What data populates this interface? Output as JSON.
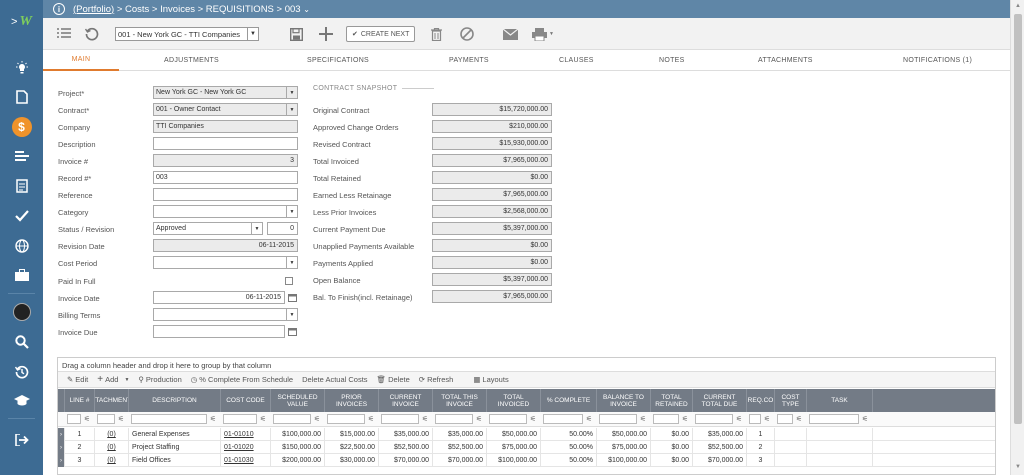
{
  "breadcrumb": {
    "portfolio": "(Portfolio)",
    "path": " > Costs > Invoices > REQUISITIONS > 003 ",
    "caret": "⌄"
  },
  "toolbar": {
    "record_select": "001 - New York GC - TTI Companies",
    "create_next": "CREATE NEXT"
  },
  "tabs": [
    "MAIN",
    "ADJUSTMENTS",
    "SPECIFICATIONS",
    "PAYMENTS",
    "CLAUSES",
    "NOTES",
    "ATTACHMENTS",
    "NOTIFICATIONS (1)"
  ],
  "form": {
    "labels": {
      "project": "Project*",
      "contract": "Contract*",
      "company": "Company",
      "description": "Description",
      "invoice_no": "Invoice #",
      "record_no": "Record #*",
      "reference": "Reference",
      "category": "Category",
      "status_revision": "Status / Revision",
      "revision_date": "Revision Date",
      "cost_period": "Cost Period",
      "paid_in_full": "Paid In Full",
      "invoice_date": "Invoice Date",
      "billing_terms": "Billing Terms",
      "invoice_due": "Invoice Due"
    },
    "values": {
      "project": "New York GC - New York GC",
      "contract": "001 - Owner Contact",
      "company": "TTI Companies",
      "description": "",
      "invoice_no": "3",
      "record_no": "003",
      "reference": "",
      "category": "",
      "status": "Approved",
      "revision": "0",
      "revision_date": "06-11-2015",
      "cost_period": "",
      "invoice_date": "06-11-2015",
      "billing_terms": "",
      "invoice_due": ""
    }
  },
  "snapshot": {
    "title": "CONTRACT SNAPSHOT",
    "rows": [
      {
        "label": "Original Contract",
        "value": "$15,720,000.00"
      },
      {
        "label": "Approved Change Orders",
        "value": "$210,000.00"
      },
      {
        "label": "Revised Contract",
        "value": "$15,930,000.00"
      },
      {
        "label": "Total Invoiced",
        "value": "$7,965,000.00"
      },
      {
        "label": "Total Retained",
        "value": "$0.00"
      },
      {
        "label": "Earned Less Retainage",
        "value": "$7,965,000.00"
      },
      {
        "label": "Less Prior Invoices",
        "value": "$2,568,000.00"
      },
      {
        "label": "Current Payment Due",
        "value": "$5,397,000.00"
      },
      {
        "label": "Unapplied Payments Available",
        "value": "$0.00"
      },
      {
        "label": "Payments Applied",
        "value": "$0.00"
      },
      {
        "label": "Open Balance",
        "value": "$5,397,000.00"
      },
      {
        "label": "Bal. To Finish(incl. Retainage)",
        "value": "$7,965,000.00"
      }
    ]
  },
  "grid": {
    "group_hint": "Drag a column header and drop it here to group by that column",
    "tools": {
      "edit": "Edit",
      "add": "Add",
      "production": "Production",
      "pct_schedule": "% Complete From Schedule",
      "delete_actual": "Delete Actual Costs",
      "delete": "Delete",
      "refresh": "Refresh",
      "layouts": "Layouts"
    },
    "headers": [
      "LINE #",
      "ATTACHMENTS",
      "DESCRIPTION",
      "COST CODE",
      "SCHEDULED VALUE",
      "PRIOR INVOICES",
      "CURRENT INVOICE",
      "TOTAL THIS INVOICE",
      "TOTAL INVOICED",
      "% COMPLETE",
      "BALANCE TO INVOICE",
      "TOTAL RETAINED",
      "CURRENT TOTAL DUE",
      "REQ.CO",
      "COST TYPE",
      "TASK"
    ],
    "rows": [
      [
        "1",
        "(0)",
        "General Expenses",
        "01-01010",
        "$100,000.00",
        "$15,000.00",
        "$35,000.00",
        "$35,000.00",
        "$50,000.00",
        "50.00%",
        "$50,000.00",
        "$0.00",
        "$35,000.00",
        "1",
        "",
        ""
      ],
      [
        "2",
        "(0)",
        "Project Staffing",
        "01-01020",
        "$150,000.00",
        "$22,500.00",
        "$52,500.00",
        "$52,500.00",
        "$75,000.00",
        "50.00%",
        "$75,000.00",
        "$0.00",
        "$52,500.00",
        "2",
        "",
        ""
      ],
      [
        "3",
        "(0)",
        "Field Offices",
        "01-01030",
        "$200,000.00",
        "$30,000.00",
        "$70,000.00",
        "$70,000.00",
        "$100,000.00",
        "50.00%",
        "$100,000.00",
        "$0.00",
        "$70,000.00",
        "3",
        "",
        ""
      ]
    ]
  },
  "colors": {
    "sidebar": "#3d6b93",
    "topbar": "#5f86a7",
    "accent": "#e07b2e",
    "grid_header": "#737b86"
  }
}
